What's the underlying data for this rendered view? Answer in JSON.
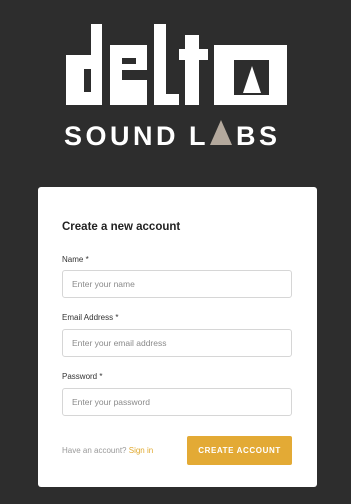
{
  "brand": {
    "logo_word": "delta",
    "tagline": "SOUND LABS",
    "accent_color": "#b4a99d"
  },
  "form": {
    "title": "Create a new account",
    "fields": [
      {
        "label": "Name *",
        "placeholder": "Enter your name",
        "value": ""
      },
      {
        "label": "Email Address *",
        "placeholder": "Enter your email address",
        "value": ""
      },
      {
        "label": "Password *",
        "placeholder": "Enter your password",
        "value": ""
      }
    ],
    "footer_prompt": "Have an account?",
    "signin_label": "Sign in",
    "submit_label": "CREATE ACCOUNT",
    "button_color": "#e3aa35",
    "link_color": "#e0a92e"
  }
}
